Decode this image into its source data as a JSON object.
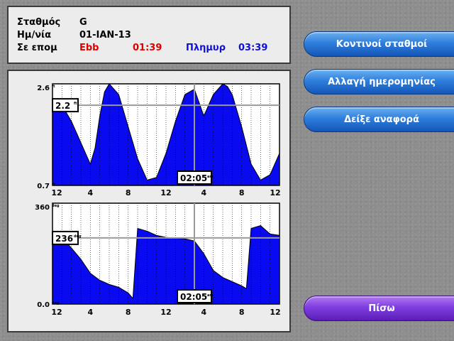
{
  "station": {
    "station_label": "Σταθμός",
    "station_value": "G",
    "date_label": "Ημ/νία",
    "date_value": "01-IAN-13",
    "now_label": "Σε επομ",
    "ebb_label": "Ebb",
    "ebb_time": "01:39",
    "flood_label": "Πλημυρ",
    "flood_time": "03:39"
  },
  "buttons": {
    "nearby_stations": "Κοντινοί σταθμοί",
    "change_date": "Αλλαγή ημερομηνίας",
    "show_report": "Δείξε αναφορά",
    "back": "Πίσω"
  },
  "colors": {
    "fill": "#0a0af0",
    "ebb": "#e00000",
    "flood": "#1010d0",
    "button_blue": "#2f7fdc",
    "button_purple": "#7f3ee0"
  },
  "chart_data": [
    {
      "type": "area",
      "x_tick_labels": [
        "12",
        "4",
        "8",
        "12",
        "4",
        "8",
        "12"
      ],
      "y_max_label": "2.6",
      "y_max_unit": "ft",
      "y_min_label": "0.7",
      "y_min_unit": "ft",
      "ylim": [
        0.7,
        2.6
      ],
      "xlim": [
        0,
        24
      ],
      "cursor_value": "2.2",
      "cursor_value_unit": "ft",
      "cursor_time": "02:05",
      "cursor_time_unit": "am",
      "cursor_x": 15,
      "cursor_y": 2.2,
      "x": [
        0,
        1,
        2,
        3,
        4,
        4.5,
        5,
        5.5,
        6,
        7,
        8,
        9,
        10,
        11,
        12,
        13,
        14,
        15,
        16,
        17,
        18,
        18.5,
        19,
        20,
        21,
        22,
        23,
        24
      ],
      "values": [
        2.2,
        2.2,
        1.9,
        1.5,
        1.1,
        1.4,
        2.0,
        2.45,
        2.6,
        2.4,
        1.8,
        1.2,
        0.8,
        0.85,
        1.3,
        1.9,
        2.4,
        2.5,
        2.0,
        2.4,
        2.6,
        2.55,
        2.4,
        1.8,
        1.1,
        0.8,
        0.9,
        1.3
      ]
    },
    {
      "type": "area",
      "x_tick_labels": [
        "12",
        "4",
        "8",
        "12",
        "4",
        "8",
        "12"
      ],
      "y_max_label": "360",
      "y_max_unit": "deg",
      "y_min_label": "0.0",
      "y_min_unit": "deg",
      "ylim": [
        0,
        360
      ],
      "xlim": [
        0,
        24
      ],
      "cursor_value": "236",
      "cursor_value_unit": "deg",
      "cursor_time": "02:05",
      "cursor_time_unit": "am",
      "cursor_x": 15,
      "cursor_y": 236,
      "x": [
        0,
        1,
        2,
        3,
        4,
        5,
        6,
        7,
        8,
        8.5,
        9,
        10,
        11,
        12,
        13,
        14,
        15,
        16,
        17,
        18,
        19,
        20,
        20.5,
        21,
        22,
        23,
        24
      ],
      "values": [
        236,
        236,
        200,
        160,
        110,
        85,
        70,
        60,
        40,
        20,
        270,
        260,
        245,
        238,
        235,
        233,
        225,
        180,
        120,
        95,
        80,
        65,
        55,
        270,
        280,
        250,
        245
      ]
    }
  ]
}
